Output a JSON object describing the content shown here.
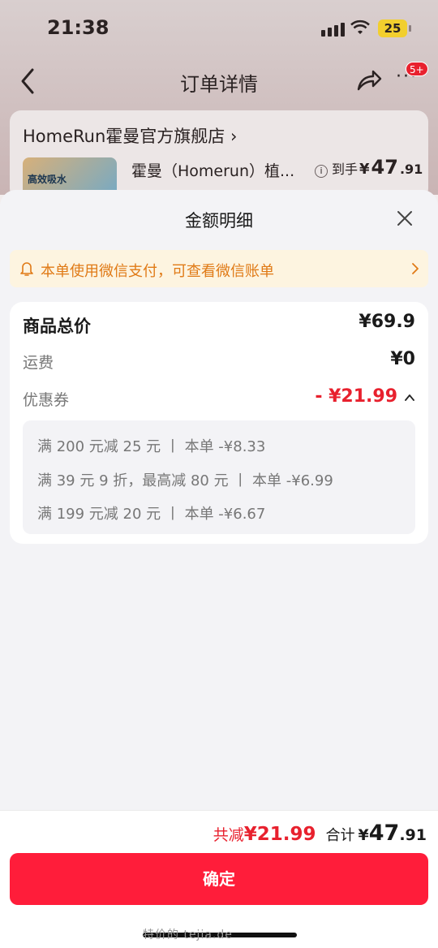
{
  "status_bar": {
    "time": "21:38",
    "battery": "25"
  },
  "nav": {
    "title": "订单详情",
    "badge": "5+"
  },
  "store": {
    "name": "HomeRun霍曼官方旗舰店 ›",
    "product_name": "霍曼（Homerun）植...",
    "price_label": "到手",
    "price_yen": "¥",
    "price_int": "47",
    "price_dec": ".91",
    "thumb_text": "高效吸水"
  },
  "sheet": {
    "title": "金额明细",
    "notice": "本单使用微信支付，可查看微信账单",
    "rows": [
      {
        "label": "商品总价",
        "value": "¥69.9"
      },
      {
        "label": "运费",
        "value": "¥0"
      },
      {
        "label": "优惠券",
        "value": "- ¥21.99"
      }
    ],
    "coupons": [
      "满 200 元减 25 元  丨 本单 -¥8.33",
      "满 39 元 9 折，最高减 80 元  丨 本单 -¥6.99",
      "满 199 元减 20 元  丨 本单 -¥6.67"
    ]
  },
  "footer": {
    "discount_label": "共减",
    "discount_value": "¥21.99",
    "total_label": "合计",
    "total_yen": "¥",
    "total_int": "47",
    "total_dec": ".91",
    "confirm_label": "确定",
    "watermark": "特价的 tejia.de"
  },
  "colors": {
    "accent_red": "#ff1d3a",
    "discount_red": "#e8212e",
    "notice_orange": "#e07a16",
    "notice_bg": "#fdf4e0"
  },
  "icons": [
    "back-icon",
    "share-icon",
    "more-icon",
    "info-icon",
    "close-icon",
    "bell-icon",
    "chevron-right-icon",
    "chevron-up-icon"
  ]
}
